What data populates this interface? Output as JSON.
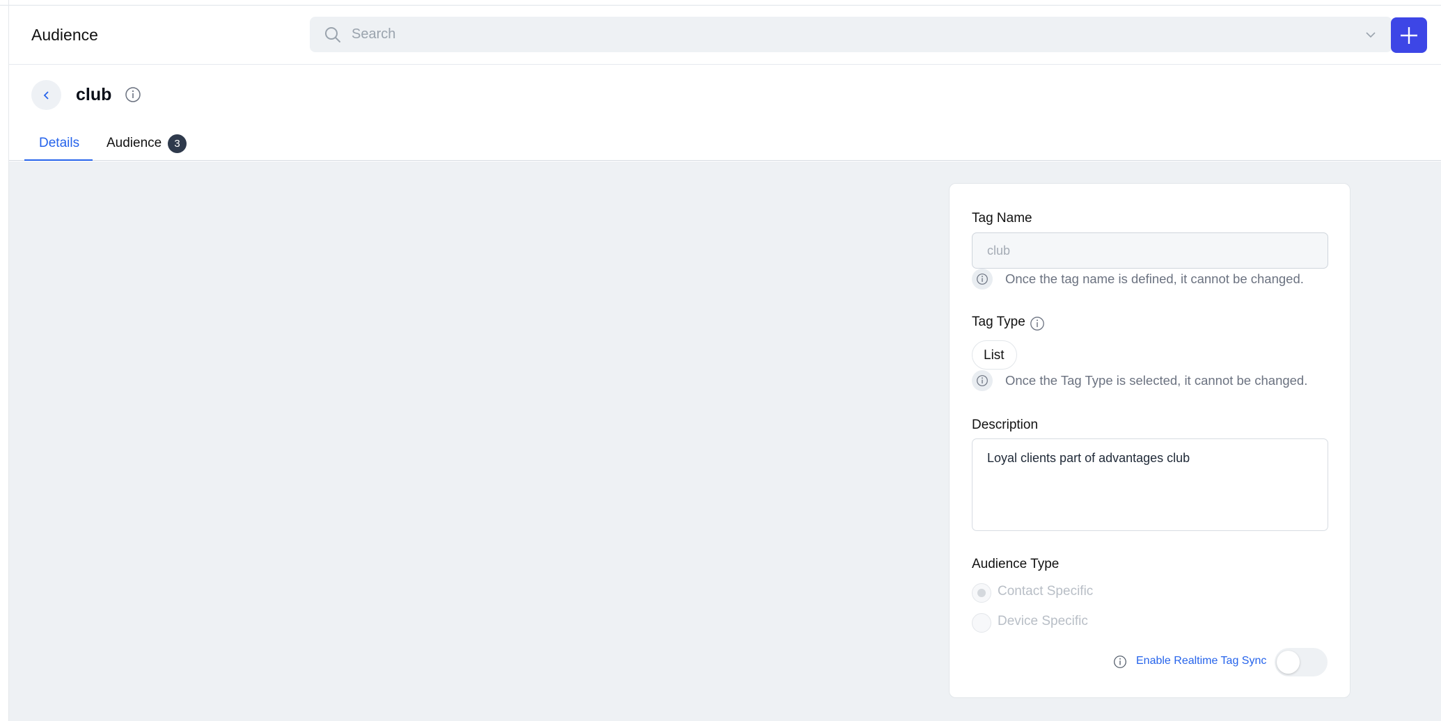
{
  "header": {
    "app_title": "Audience",
    "search_placeholder": "Search",
    "icons": {
      "search": "search-icon",
      "dropdown": "chevron-down-icon",
      "add": "plus-icon"
    },
    "accent_color": "#3d46e6"
  },
  "page": {
    "title": "club",
    "icons": {
      "back": "chevron-left-icon",
      "info": "info-icon"
    },
    "tabs": [
      {
        "label": "Details",
        "active": true
      },
      {
        "label": "Audience",
        "badge": "3",
        "active": false
      }
    ]
  },
  "form": {
    "tag_name": {
      "label": "Tag Name",
      "value": "club",
      "help": "Once the tag name is defined, it cannot be changed."
    },
    "tag_type": {
      "label": "Tag Type",
      "value": "List",
      "help": "Once the Tag Type is selected, it cannot be changed."
    },
    "description": {
      "label": "Description",
      "value": "Loyal clients part of advantages club"
    },
    "audience_type": {
      "label": "Audience Type",
      "options": [
        {
          "label": "Contact Specific",
          "selected": true,
          "disabled": true
        },
        {
          "label": "Device Specific",
          "selected": false,
          "disabled": true
        }
      ]
    },
    "realtime_sync": {
      "label": "Enable Realtime Tag Sync",
      "enabled": false
    }
  }
}
